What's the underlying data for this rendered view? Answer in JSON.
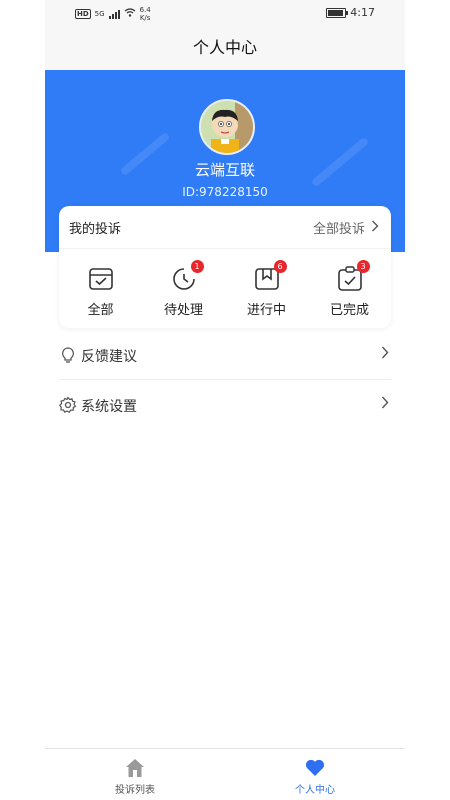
{
  "status_bar": {
    "network": "5G",
    "hd": "HD",
    "speed_value": "6.4",
    "speed_unit": "K/s",
    "time": "4:17"
  },
  "header": {
    "title": "个人中心"
  },
  "profile": {
    "username": "云端互联",
    "user_id": "ID:978228150",
    "accent_color": "#2f7cf6"
  },
  "complaints_card": {
    "title": "我的投诉",
    "view_all_label": "全部投诉",
    "items": [
      {
        "label": "全部",
        "icon": "calendar-check-icon",
        "badge": ""
      },
      {
        "label": "待处理",
        "icon": "clock-pending-icon",
        "badge": "1"
      },
      {
        "label": "进行中",
        "icon": "box-progress-icon",
        "badge": "6"
      },
      {
        "label": "已完成",
        "icon": "clipboard-check-icon",
        "badge": "3"
      }
    ]
  },
  "menu": [
    {
      "label": "反馈建议",
      "icon": "lightbulb-icon"
    },
    {
      "label": "系统设置",
      "icon": "gear-icon"
    }
  ],
  "tab_bar": {
    "active": "个人中心",
    "tabs": [
      {
        "label": "投诉列表",
        "icon": "home-icon"
      },
      {
        "label": "个人中心",
        "icon": "heart-icon"
      }
    ],
    "active_color": "#2f6ff2"
  }
}
